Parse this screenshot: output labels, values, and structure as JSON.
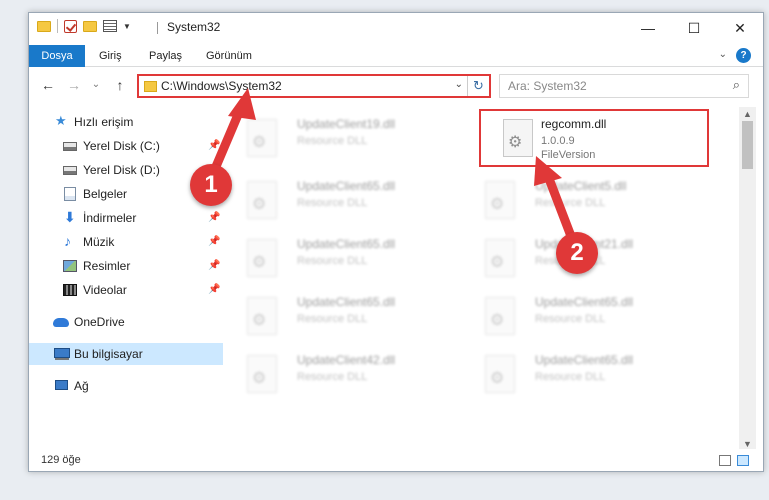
{
  "window": {
    "title": "System32",
    "controls": {
      "minimize": "—",
      "maximize": "☐",
      "close": "✕"
    }
  },
  "ribbon": {
    "tabs": [
      "Dosya",
      "Giriş",
      "Paylaş",
      "Görünüm"
    ],
    "expand_glyph": "⌄",
    "help_glyph": "?"
  },
  "navbar": {
    "back": "←",
    "forward": "→",
    "recent": "⌄",
    "up": "↑",
    "address": "C:\\Windows\\System32",
    "address_dropdown": "⌄",
    "refresh": "↻",
    "search_placeholder": "Ara: System32",
    "search_icon": "⌕"
  },
  "navpane": {
    "items": [
      {
        "label": "Hızlı erişim",
        "icon": "star-icon",
        "pinned": false
      },
      {
        "label": "Yerel Disk (C:)",
        "icon": "drive-icon",
        "pinned": true
      },
      {
        "label": "Yerel Disk (D:)",
        "icon": "drive-icon",
        "pinned": true
      },
      {
        "label": "Belgeler",
        "icon": "documents-icon",
        "pinned": true
      },
      {
        "label": "İndirmeler",
        "icon": "downloads-icon",
        "pinned": true
      },
      {
        "label": "Müzik",
        "icon": "music-icon",
        "pinned": true
      },
      {
        "label": "Resimler",
        "icon": "pictures-icon",
        "pinned": true
      },
      {
        "label": "Videolar",
        "icon": "videos-icon",
        "pinned": true
      },
      {
        "label": "OneDrive",
        "icon": "onedrive-icon",
        "pinned": false
      },
      {
        "label": "Bu bilgisayar",
        "icon": "computer-icon",
        "pinned": false,
        "selected": true
      },
      {
        "label": "Ağ",
        "icon": "network-icon",
        "pinned": false
      }
    ],
    "pin_glyph": "📌"
  },
  "files": [
    {
      "name": "UpdateClient19.dll",
      "type": "Resource DLL",
      "blurred": true
    },
    {
      "name": "regcomm.dll",
      "version": "1.0.0.9",
      "type": "FileVersion",
      "blurred": false,
      "highlighted": true
    },
    {
      "name": "UpdateClient65.dll",
      "type": "Resource DLL",
      "blurred": true
    },
    {
      "name": "UpdateClient5.dll",
      "type": "Resource DLL",
      "blurred": true
    },
    {
      "name": "UpdateClient65.dll",
      "type": "Resource DLL",
      "blurred": true
    },
    {
      "name": "UpdateClient21.dll",
      "type": "Resource DLL",
      "blurred": true
    },
    {
      "name": "UpdateClient65.dll",
      "type": "Resource DLL",
      "blurred": true
    },
    {
      "name": "UpdateClient65.dll",
      "type": "Resource DLL",
      "blurred": true
    },
    {
      "name": "UpdateClient42.dll",
      "type": "Resource DLL",
      "blurred": true
    },
    {
      "name": "UpdateClient65.dll",
      "type": "Resource DLL",
      "blurred": true
    }
  ],
  "statusbar": {
    "count": "129 öğe"
  },
  "annotations": {
    "callout_1": "1",
    "callout_2": "2",
    "color": "#e03838"
  },
  "colors": {
    "accent": "#1979ca",
    "selection": "#cce8ff",
    "annotation": "#e03838"
  }
}
